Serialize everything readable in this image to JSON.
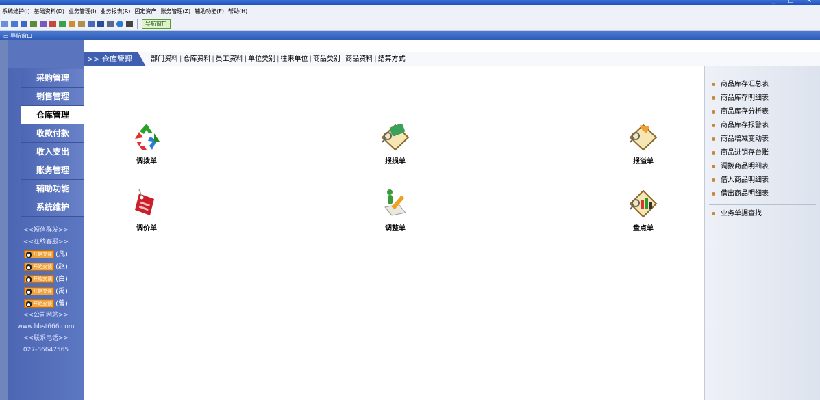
{
  "menubar": {
    "items": [
      "系统维护(I)",
      "基础资料(D)",
      "业务管理(I)",
      "业务报表(R)",
      "固定资产",
      "账务管理(Z)",
      "辅助功能(F)",
      "帮助(H)"
    ]
  },
  "toolbar": {
    "nav_button_label": "导航窗口"
  },
  "nav_header": {
    "title": "导航窗口"
  },
  "sidebar": {
    "items": [
      {
        "label": "采购管理"
      },
      {
        "label": "销售管理"
      },
      {
        "label": "仓库管理"
      },
      {
        "label": "收款付款"
      },
      {
        "label": "收入支出"
      },
      {
        "label": "账务管理"
      },
      {
        "label": "辅助功能"
      },
      {
        "label": "系统维护"
      }
    ],
    "active_index": 2,
    "links": {
      "sms": "<<短信群发>>",
      "support": "<<在线客服>>",
      "qq_label": "开始交谈",
      "qq_names": [
        "(凡)",
        "(赵)",
        "(白)",
        "(禹)",
        "(曾)"
      ],
      "website_title": "<<公司网站>>",
      "website": "www.hbst666.com",
      "phone_title": "<<联系电话>>",
      "phone": "027-86647565"
    }
  },
  "breadcrumb": {
    "current": ">> 仓库管理",
    "links": [
      "部门资料",
      "仓库资料",
      "员工资料",
      "单位类别",
      "往来单位",
      "商品类别",
      "商品资料",
      "结算方式"
    ]
  },
  "main": {
    "items": [
      {
        "label": "调拨单",
        "icon": "recycle-icon"
      },
      {
        "label": "报损单",
        "icon": "damage-report-icon"
      },
      {
        "label": "报溢单",
        "icon": "overflow-report-icon"
      },
      {
        "label": "调价单",
        "icon": "price-tag-icon"
      },
      {
        "label": "调整单",
        "icon": "adjust-form-icon"
      },
      {
        "label": "盘点单",
        "icon": "inventory-check-icon"
      }
    ]
  },
  "right_panel": {
    "reports": [
      "商品库存汇总表",
      "商品库存明细表",
      "商品库存分析表",
      "商品库存报警表",
      "商品增减变动表",
      "商品进销存台账",
      "调拨商品明细表",
      "借入商品明细表",
      "借出商品明细表"
    ],
    "search": "业务单据查找"
  },
  "colors": {
    "sidebar": "#5068b6",
    "titlebar": "#2c5cc5",
    "accent_tab": "#3f5fb0"
  }
}
